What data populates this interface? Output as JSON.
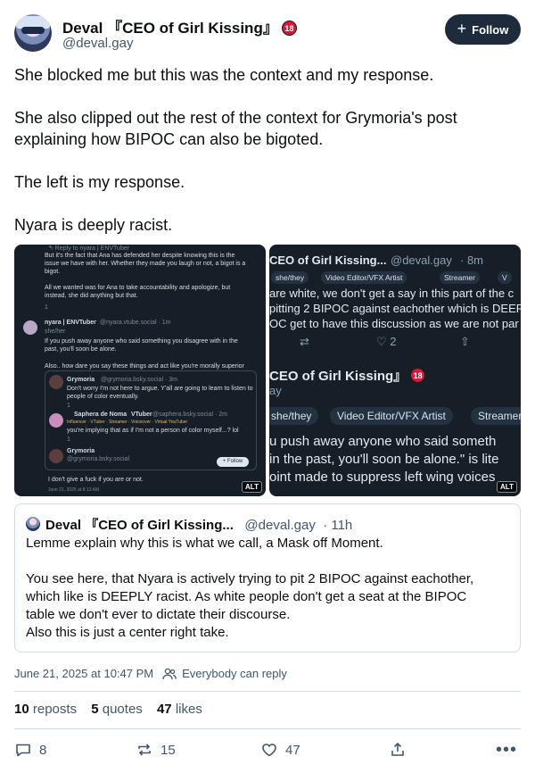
{
  "author": {
    "display_name": "Deval 『CEO of Girl Kissing』",
    "badge": "18",
    "handle": "@deval.gay"
  },
  "follow_button": {
    "label": "Follow",
    "icon": "plus-icon"
  },
  "post": {
    "paragraphs": [
      "She blocked me but this was the context and my response.",
      "She also clipped out the rest of the context for Grymoria's post explaining how BIPOC can also be bigoted.",
      "The left is my response.",
      "Nyara is deeply racist."
    ]
  },
  "images": [
    {
      "alt_label": "ALT",
      "lines": {
        "reply_to": "↰ Reply to nyara | ENVTuber",
        "p1": "But it's the fact that Ana has defended her despite knowing this is the",
        "p2": "issue we have with her. Whether they made you laugh or not, a bigot is a",
        "p3": "bigot.",
        "p4": "All we wanted was for Ana to take accountability and apologize, but",
        "p5": "instead, she did anything but that.",
        "n_name": "nyara | ENVTuber",
        "n_handle": "@nyara.vtube.social · 1m",
        "n_pron": "she/her",
        "n1": "If you push away anyone who said something you disagree with in the",
        "n2": "past, you'll soon be alone.",
        "n3": "Also.. how dare you say these things and act like you're morally superior",
        "g_name": "Grymoria",
        "g_handle": "@grymoria.bsky.social · 3m",
        "g1": "Don't worry I'm not here to argue. Y'all are going to learn to listen to",
        "g2": "people of color eventually.",
        "s_name": "Saphera de Noma",
        "s_tag": "VTuber",
        "s_handle": "@saphera.bsky.social · 2m",
        "s_tags": "Influencer · VTuber · Streamer · Voiceover · Virtual YouTuber",
        "s1": "you're implying that as if I'm not a person of color myself...? lol",
        "g2_name": "Grymoria",
        "g2_handle": "@grymoria.bsky.social",
        "mini_follow": "+ Follow",
        "last": "I don't give a fuck if you are or not.",
        "date": "June 21, 2025 at 8:13 AM",
        "c1": "1",
        "c2": "1",
        "c3": "1"
      }
    },
    {
      "alt_label": "ALT",
      "lines": {
        "name": "CEO of Girl Kissing...",
        "handle": "@deval.gay",
        "time": "· 8m",
        "tag1": "she/they",
        "tag2": "Video Editor/VFX Artist",
        "tag3": "Streamer",
        "tag4": "V",
        "l1": "are white, we don't get a say in this part of the c",
        "l2": "pitting 2 BIPOC against eachother which is DEEP",
        "l3": "OC get to have this discussion as we are not par",
        "likes": "2",
        "big_name": "CEO of Girl Kissing』",
        "big_badge": "18",
        "big_handle": "ay",
        "btag1": "she/they",
        "btag2": "Video Editor/VFX Artist",
        "btag3": "Streamer",
        "b1": "u push away anyone who said someth",
        "b2": " in the past, you'll soon be alone.\" is lite",
        "b3": "oint made to suppress left wing voices"
      }
    }
  ],
  "quote": {
    "name": "Deval 『CEO of Girl Kissing...",
    "handle": "@deval.gay",
    "time": "· 11h",
    "body_lines": [
      "Lemme explain why this is what we call, a Mask off Moment.",
      "",
      "You see here, that Nyara is actively trying to pit 2 BIPOC against eachother,",
      "which like is DEEPLY racist. As white people don't get a seat at the BIPOC",
      "table we don't ever to dictate their discourse.",
      "Also this is just a center right take."
    ]
  },
  "meta": {
    "timestamp": "June 21, 2025 at 10:47 PM",
    "reply_setting": "Everybody can reply"
  },
  "stats": {
    "reposts_count": "10",
    "reposts_label": "reposts",
    "quotes_count": "5",
    "quotes_label": "quotes",
    "likes_count": "47",
    "likes_label": "likes"
  },
  "actions": {
    "replies": "8",
    "reposts": "15",
    "likes": "47"
  },
  "colors": {
    "follow_bg": "#1e2b3c",
    "muted_text": "#42576c",
    "media_bg": "#161e27",
    "badge_red": "#d6193a"
  }
}
